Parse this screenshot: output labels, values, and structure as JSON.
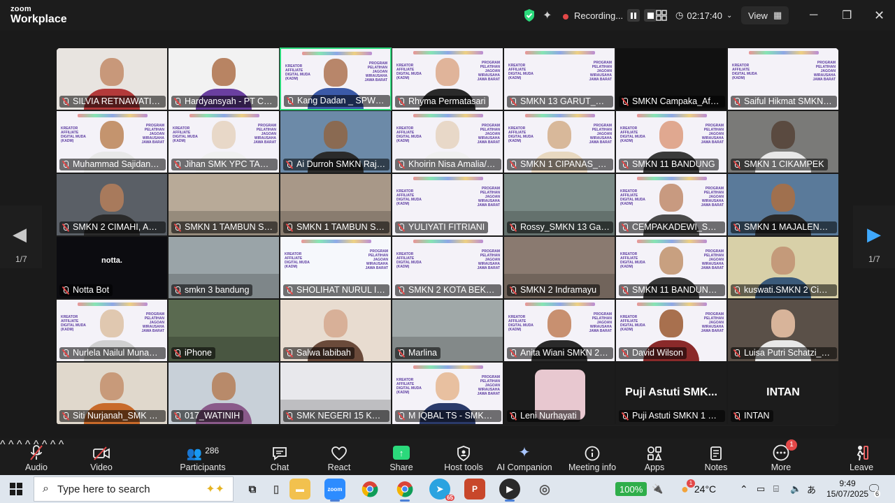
{
  "app": {
    "brand_top": "zoom",
    "brand_bottom": "Workplace"
  },
  "titlebar": {
    "recording_label": "Recording...",
    "timer": "02:17:40",
    "view_label": "View"
  },
  "gallery": {
    "page_indicator": "1/7",
    "tiles": [
      {
        "name": "SILVIA RETNAWATI SM...",
        "style": "person",
        "bg": "#e8e4e0",
        "skin": "#c8987a",
        "cloth": "#b33a3a"
      },
      {
        "name": "Hardyansyah - PT Chl...",
        "style": "person",
        "bg": "#f2f2f2",
        "skin": "#b88463",
        "cloth": "#6a3fa0"
      },
      {
        "name": "Kang Dadan _ SPW@smk...",
        "style": "slide-person",
        "bg": "#f4f2f8",
        "skin": "#b8866a",
        "cloth": "#3b5aa8"
      },
      {
        "name": "Rhyma Permatasari",
        "style": "slide-person",
        "bg": "#f4f2f8",
        "skin": "#e0b49a",
        "cloth": "#2a2a2a"
      },
      {
        "name": "SMKN 13 GARUT_AZW...",
        "style": "slide",
        "bg": "#f4f2f8"
      },
      {
        "name": "SMKN Campaka_Afwal...",
        "style": "dark",
        "bg": "#111111"
      },
      {
        "name": "Saiful Hikmat SMKN B...",
        "style": "slide",
        "bg": "#f4f2f8"
      },
      {
        "name": "Muhammad Sajidan_S...",
        "style": "slide-person",
        "bg": "#f4f2f8",
        "skin": "#c4946e",
        "cloth": "#e8e8e8"
      },
      {
        "name": "Jihan SMK YPC TASIK...",
        "style": "slide-person",
        "bg": "#f4f2f8",
        "skin": "#e8d8c8",
        "cloth": "#f0f0f0"
      },
      {
        "name": "Ai Durroh SMKN Rajap...",
        "style": "person",
        "bg": "#6c8aa8",
        "skin": "#8a6a52",
        "cloth": "#2a2a2a"
      },
      {
        "name": "Khoirin Nisa Amalia/S...",
        "style": "slide-person",
        "bg": "#f4f2f8",
        "skin": "#e8d8c8",
        "cloth": "#f0f0f0"
      },
      {
        "name": "SMKN 1 CIPANAS_Fitri...",
        "style": "slide-person",
        "bg": "#f4f2f8",
        "skin": "#d8b89a",
        "cloth": "#e8d8c0"
      },
      {
        "name": "SMKN 11 BANDUNG",
        "style": "slide-person",
        "bg": "#f4f2f8",
        "skin": "#e0a890",
        "cloth": "#3a3a3a"
      },
      {
        "name": "SMKN 1 CIKAMPEK",
        "style": "person",
        "bg": "#7a7a78",
        "skin": "#5a4a40",
        "cloth": "#e8e8e8"
      },
      {
        "name": "SMKN 2 CIMAHI, ADI F...",
        "style": "person",
        "bg": "#5a5f66",
        "skin": "#a87a5c",
        "cloth": "#2a2a2a"
      },
      {
        "name": "SMKN 1 TAMBUN SEL...",
        "style": "room",
        "bg": "#b8aa98"
      },
      {
        "name": "SMKN 1 TAMBUN SEL...",
        "style": "room",
        "bg": "#a89888"
      },
      {
        "name": "YULIYATI FITRIANI",
        "style": "slide",
        "bg": "#f4f2f8"
      },
      {
        "name": "Rossy_SMKN 13 Garut",
        "style": "room",
        "bg": "#7a8a86"
      },
      {
        "name": "CEMPAKADEWI_SMKN...",
        "style": "slide-person",
        "bg": "#f4f2f8",
        "skin": "#c89a80",
        "cloth": "#4a4a4a"
      },
      {
        "name": "SMKN 1 MAJALENGKA...",
        "style": "person",
        "bg": "#5a7a9a",
        "skin": "#a0704e",
        "cloth": "#2a2a2a"
      },
      {
        "name": "Notta Bot",
        "style": "dark",
        "bg": "#0c0c10",
        "center": "notta."
      },
      {
        "name": "smkn 3 bandung",
        "style": "room",
        "bg": "#9aa4a8"
      },
      {
        "name": "SHOLIHAT NURUL INS...",
        "style": "slide",
        "bg": "#f6f8fc"
      },
      {
        "name": "SMKN 2 KOTA BEKASI",
        "style": "slide",
        "bg": "#f4f2f8"
      },
      {
        "name": "SMKN 2 Indramayu",
        "style": "room",
        "bg": "#8a7a70"
      },
      {
        "name": "SMKN 11 BANDUNG ...",
        "style": "slide-person",
        "bg": "#f4f2f8",
        "skin": "#c8a080",
        "cloth": "#3a3a3a"
      },
      {
        "name": "kuswati.SMKN 2 Cimahi",
        "style": "person",
        "bg": "#d8d0a8",
        "skin": "#c49a7a",
        "cloth": "#3a5a7a"
      },
      {
        "name": "Nurlela Nailul Muna_S...",
        "style": "slide-person",
        "bg": "#f4f2f8",
        "skin": "#e0c8b0",
        "cloth": "#d0d0d0"
      },
      {
        "name": "iPhone",
        "style": "room",
        "bg": "#5a6a50"
      },
      {
        "name": "Salwa labibah",
        "style": "person",
        "bg": "#e8dcd0",
        "skin": "#d8b098",
        "cloth": "#6a4a3a"
      },
      {
        "name": "Marlina",
        "style": "room",
        "bg": "#a0a8a8"
      },
      {
        "name": "Anita Wiani SMKN 2 S...",
        "style": "slide-person",
        "bg": "#f4f2f8",
        "skin": "#c89070",
        "cloth": "#2a2a2a"
      },
      {
        "name": "David Wilson",
        "style": "slide-person",
        "bg": "#f4f2f8",
        "skin": "#a8704e",
        "cloth": "#8a2a2a"
      },
      {
        "name": "Luisa Putri Schatzi_SM...",
        "style": "person",
        "bg": "#5a5048",
        "skin": "#d8b49a",
        "cloth": "#e8e8e8"
      },
      {
        "name": "Siti Nurjanah_SMK Me...",
        "style": "person",
        "bg": "#e0d8cc",
        "skin": "#c89a7a",
        "cloth": "#c86a2a"
      },
      {
        "name": "017_WATINIH",
        "style": "person",
        "bg": "#c8d0d8",
        "skin": "#b88a6a",
        "cloth": "#8a5a8a"
      },
      {
        "name": "SMK NEGERI 15 KOTA ...",
        "style": "room",
        "bg": "#e8e8ec"
      },
      {
        "name": "M IQBAL TS - SMKS YP...",
        "style": "slide-person",
        "bg": "#f4f2f8",
        "skin": "#e8c0a0",
        "cloth": "#2a3a6a"
      },
      {
        "name": "Leni Nurhayati",
        "style": "avatar",
        "bg": "#1c1c1c",
        "avatar_color": "#e8c8d0"
      },
      {
        "name": "Puji Astuti SMKN 1 CIK...",
        "style": "name-only",
        "bg": "#1c1c1c",
        "center": "Puji Astuti SMK..."
      },
      {
        "name": "INTAN",
        "style": "name-only",
        "bg": "#1c1c1c",
        "center": "INTAN"
      }
    ],
    "slide_text": "KREATOR AFFILIATE DIGITAL MUDA (KADM)",
    "slide_text_right": "PROGRAM PELATIHAN JAGOAN WIRAUSAHA JAWA BARAT"
  },
  "toolbar": {
    "audio": "Audio",
    "video": "Video",
    "participants": "Participants",
    "participants_count": "286",
    "chat": "Chat",
    "react": "React",
    "share": "Share",
    "host_tools": "Host tools",
    "ai_companion": "AI Companion",
    "meeting_info": "Meeting info",
    "apps": "Apps",
    "notes": "Notes",
    "more": "More",
    "more_badge": "1",
    "leave": "Leave"
  },
  "taskbar": {
    "search_placeholder": "Type here to search",
    "zoom_app_label": "zoom",
    "telegram_badge": "65",
    "battery": "100%",
    "weather_badge": "1",
    "temperature": "24°C",
    "time": "9:49",
    "date": "15/07/2025",
    "notification_count": "6"
  },
  "colors": {
    "accent": "#2bd97b",
    "danger": "#e34848",
    "slide_purple": "#5b3aa0"
  }
}
